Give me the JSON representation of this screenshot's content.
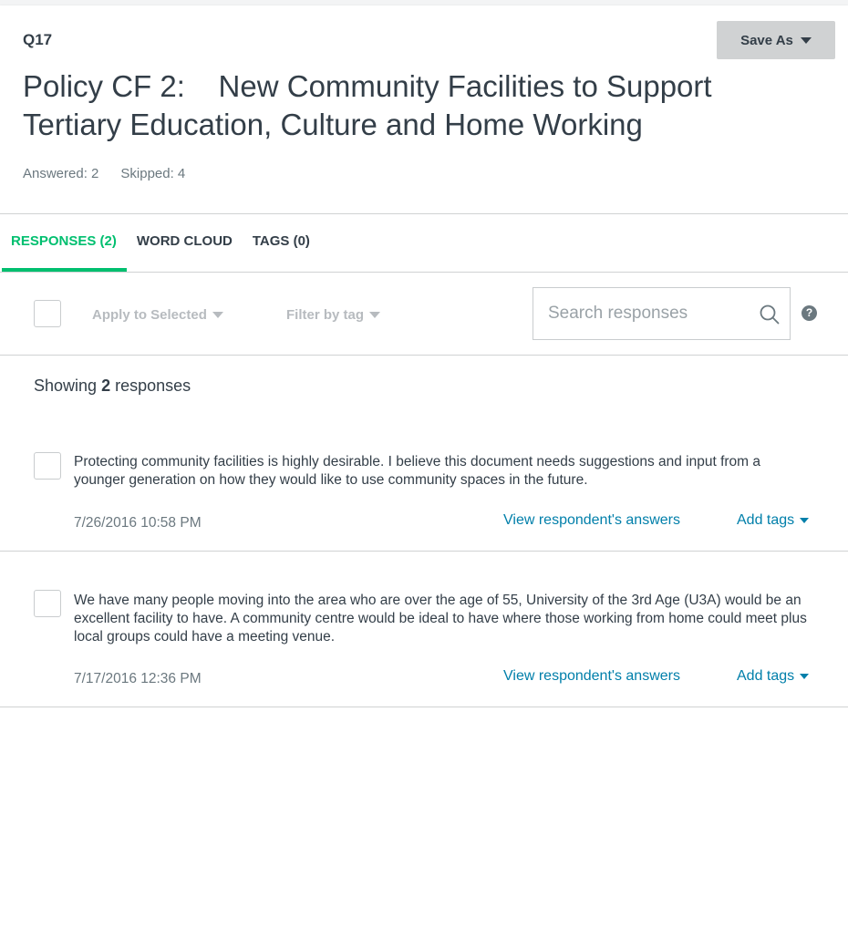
{
  "question": {
    "number": "Q17",
    "title": "Policy CF 2:    New Community Facilities to Support Tertiary Education, Culture and Home Working",
    "answered": "Answered: 2",
    "skipped": "Skipped: 4"
  },
  "header": {
    "save_as_label": "Save As"
  },
  "tabs": [
    {
      "label": "RESPONSES (2)",
      "active": true
    },
    {
      "label": "WORD CLOUD",
      "active": false
    },
    {
      "label": "TAGS (0)",
      "active": false
    }
  ],
  "toolbar": {
    "apply_label": "Apply to Selected",
    "filter_label": "Filter by tag",
    "search_placeholder": "Search responses",
    "help_label": "?"
  },
  "summary": {
    "prefix": "Showing ",
    "count": "2",
    "suffix": " responses"
  },
  "responses": [
    {
      "text": "Protecting community facilities is highly desirable. I believe this document needs suggestions and input from a younger generation on how they would like to use community spaces in the future.",
      "date": "7/26/2016 10:58 PM",
      "view_label": "View respondent's answers",
      "tags_label": "Add tags"
    },
    {
      "text": "We have many people moving into the area who are over the age of 55, University of the 3rd Age (U3A) would be an excellent facility to have. A community centre would be ideal to have where those working from home could meet plus local groups could have a meeting venue.",
      "date": "7/17/2016 12:36 PM",
      "view_label": "View respondent's answers",
      "tags_label": "Add tags"
    }
  ],
  "colors": {
    "accent": "#00bf6f",
    "link": "#007faa",
    "text": "#333e48",
    "muted": "#6b787f"
  }
}
